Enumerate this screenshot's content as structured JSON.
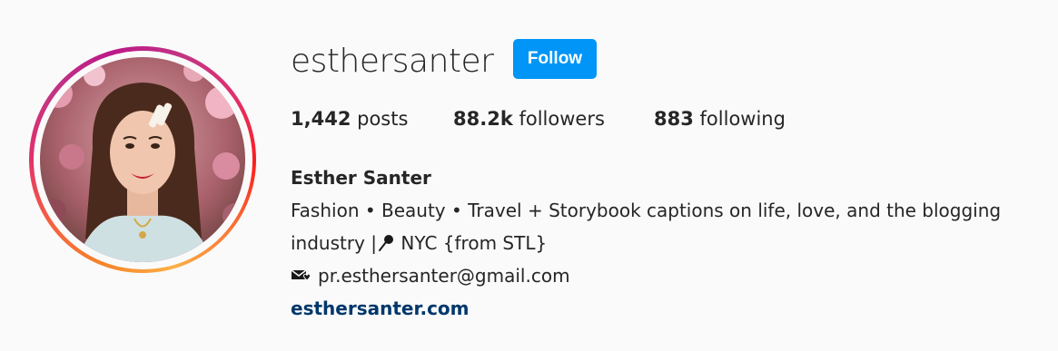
{
  "profile": {
    "username": "esthersanter",
    "follow_label": "Follow",
    "stats": {
      "posts_count": "1,442",
      "posts_label": "posts",
      "followers_count": "88.2k",
      "followers_label": "followers",
      "following_count": "883",
      "following_label": "following"
    },
    "full_name": "Esther Santer",
    "bio_line1": "Fashion • Beauty • Travel + Storybook captions on life, love, and the blogging",
    "bio_line2_prefix": "industry |",
    "bio_line2_suffix": " NYC {from STL}",
    "email": "pr.esthersanter@gmail.com",
    "website": "esthersanter.com",
    "icons": {
      "pin": "round-pushpin-icon",
      "mail": "love-letter-icon"
    }
  },
  "colors": {
    "follow_button": "#0095f6",
    "link": "#00376b",
    "text": "#262626",
    "background": "#fafafa"
  }
}
